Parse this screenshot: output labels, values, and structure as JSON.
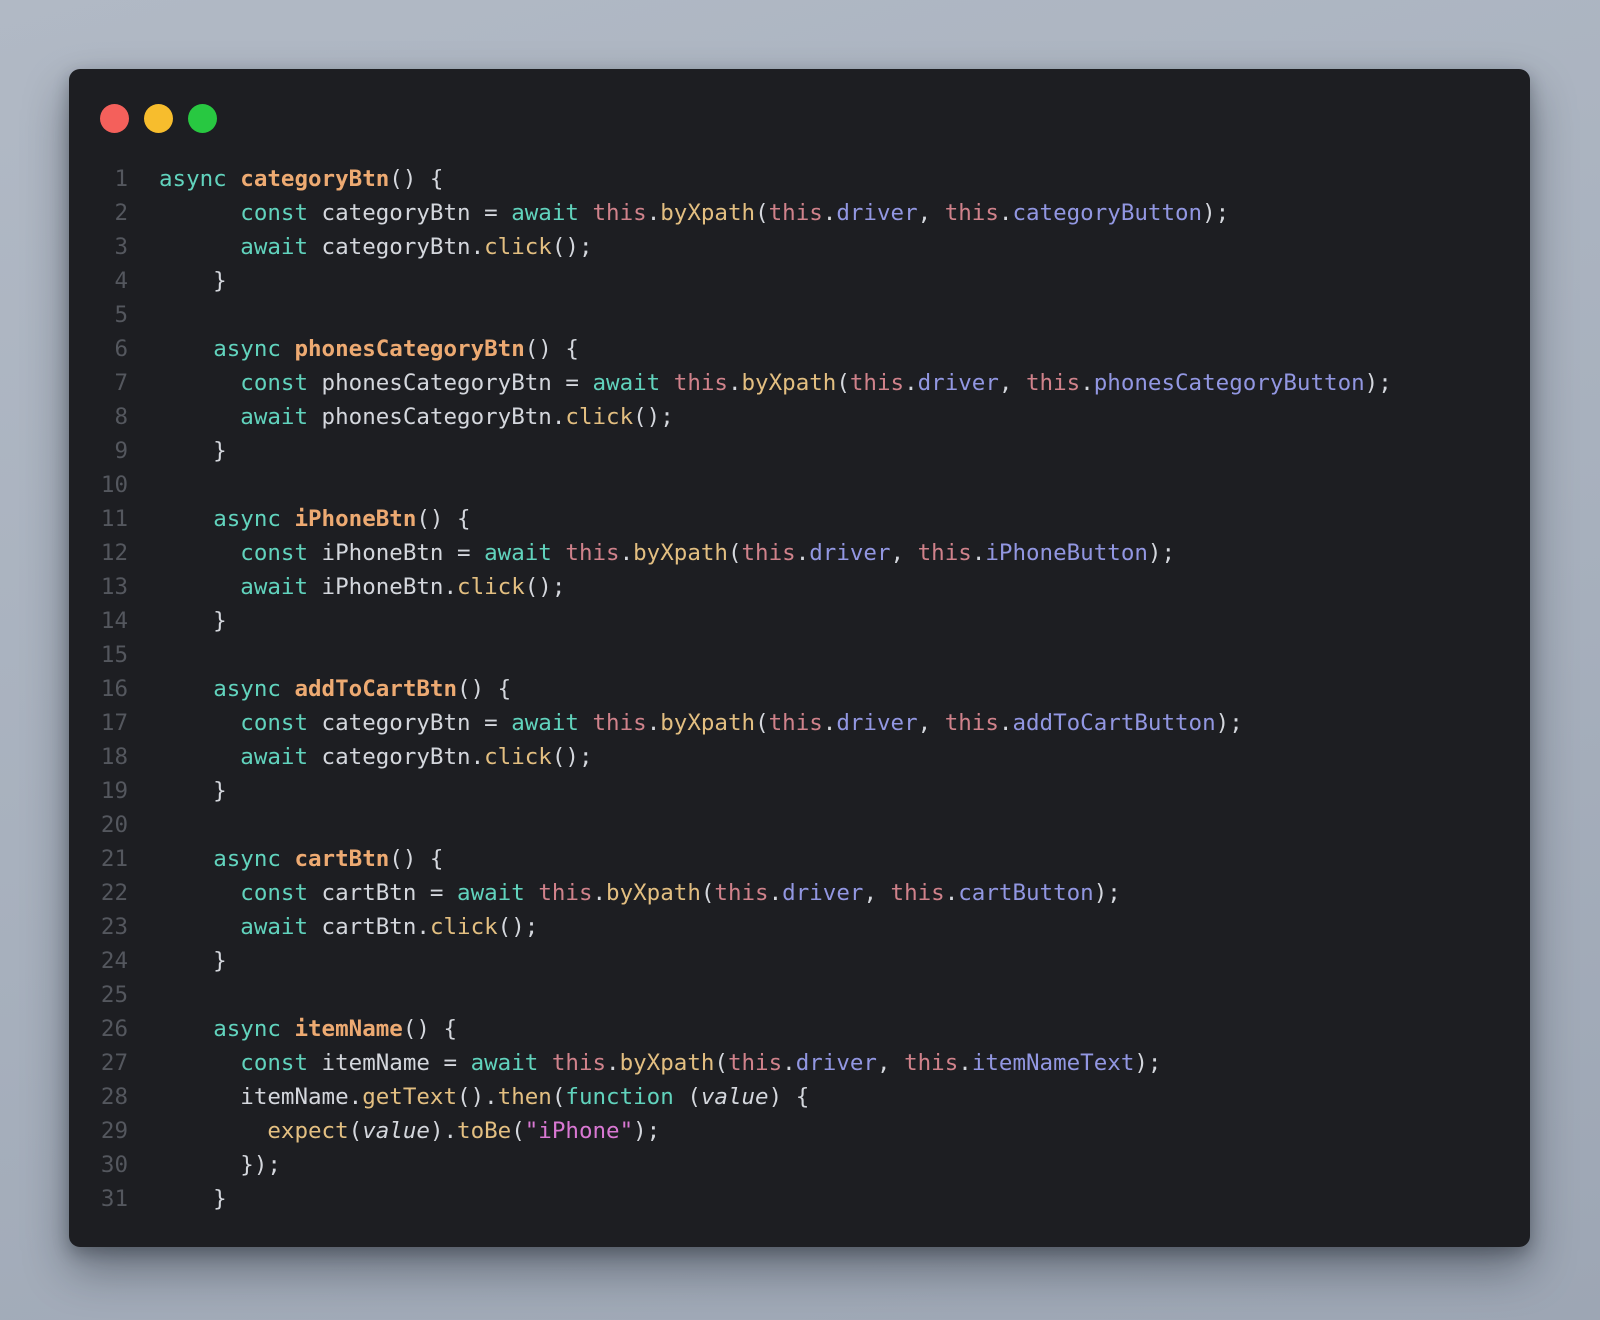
{
  "palette": {
    "page_top": "#b1b9c5",
    "page_bottom": "#9da6b4",
    "window_bg": "#1d1e22",
    "dot_red": "#f4605b",
    "dot_yellow": "#f7bd2d",
    "dot_green": "#28c841",
    "ln": "#54575e",
    "kw": "#61d3bd",
    "fn": "#edaa72",
    "pln": "#d4d7dd",
    "self": "#d0828b",
    "meth": "#e3bf81",
    "prop": "#9297e2",
    "str": "#d978d3",
    "param": "#d4d7dd"
  },
  "window": {
    "controls": [
      {
        "name": "close",
        "color_key": "dot_red"
      },
      {
        "name": "minimize",
        "color_key": "dot_yellow"
      },
      {
        "name": "zoom",
        "color_key": "dot_green"
      }
    ]
  },
  "editor": {
    "lines": [
      {
        "n": "1",
        "tokens": [
          [
            "kw",
            "async "
          ],
          [
            "fn",
            "categoryBtn"
          ],
          [
            "pln",
            "() {"
          ]
        ]
      },
      {
        "n": "2",
        "tokens": [
          [
            "pln",
            "      "
          ],
          [
            "kw",
            "const"
          ],
          [
            "pln",
            " categoryBtn = "
          ],
          [
            "kw",
            "await"
          ],
          [
            "pln",
            " "
          ],
          [
            "self",
            "this"
          ],
          [
            "pln",
            "."
          ],
          [
            "meth",
            "byXpath"
          ],
          [
            "pln",
            "("
          ],
          [
            "self",
            "this"
          ],
          [
            "pln",
            "."
          ],
          [
            "prop",
            "driver"
          ],
          [
            "pln",
            ", "
          ],
          [
            "self",
            "this"
          ],
          [
            "pln",
            "."
          ],
          [
            "prop",
            "categoryButton"
          ],
          [
            "pln",
            ");"
          ]
        ]
      },
      {
        "n": "3",
        "tokens": [
          [
            "pln",
            "      "
          ],
          [
            "kw",
            "await"
          ],
          [
            "pln",
            " categoryBtn."
          ],
          [
            "meth",
            "click"
          ],
          [
            "pln",
            "();"
          ]
        ]
      },
      {
        "n": "4",
        "tokens": [
          [
            "pln",
            "    }"
          ]
        ]
      },
      {
        "n": "5",
        "tokens": []
      },
      {
        "n": "6",
        "tokens": [
          [
            "pln",
            "    "
          ],
          [
            "kw",
            "async "
          ],
          [
            "fn",
            "phonesCategoryBtn"
          ],
          [
            "pln",
            "() {"
          ]
        ]
      },
      {
        "n": "7",
        "tokens": [
          [
            "pln",
            "      "
          ],
          [
            "kw",
            "const"
          ],
          [
            "pln",
            " phonesCategoryBtn = "
          ],
          [
            "kw",
            "await"
          ],
          [
            "pln",
            " "
          ],
          [
            "self",
            "this"
          ],
          [
            "pln",
            "."
          ],
          [
            "meth",
            "byXpath"
          ],
          [
            "pln",
            "("
          ],
          [
            "self",
            "this"
          ],
          [
            "pln",
            "."
          ],
          [
            "prop",
            "driver"
          ],
          [
            "pln",
            ", "
          ],
          [
            "self",
            "this"
          ],
          [
            "pln",
            "."
          ],
          [
            "prop",
            "phonesCategoryButton"
          ],
          [
            "pln",
            ");"
          ]
        ]
      },
      {
        "n": "8",
        "tokens": [
          [
            "pln",
            "      "
          ],
          [
            "kw",
            "await"
          ],
          [
            "pln",
            " phonesCategoryBtn."
          ],
          [
            "meth",
            "click"
          ],
          [
            "pln",
            "();"
          ]
        ]
      },
      {
        "n": "9",
        "tokens": [
          [
            "pln",
            "    }"
          ]
        ]
      },
      {
        "n": "10",
        "tokens": []
      },
      {
        "n": "11",
        "tokens": [
          [
            "pln",
            "    "
          ],
          [
            "kw",
            "async "
          ],
          [
            "fn",
            "iPhoneBtn"
          ],
          [
            "pln",
            "() {"
          ]
        ]
      },
      {
        "n": "12",
        "tokens": [
          [
            "pln",
            "      "
          ],
          [
            "kw",
            "const"
          ],
          [
            "pln",
            " iPhoneBtn = "
          ],
          [
            "kw",
            "await"
          ],
          [
            "pln",
            " "
          ],
          [
            "self",
            "this"
          ],
          [
            "pln",
            "."
          ],
          [
            "meth",
            "byXpath"
          ],
          [
            "pln",
            "("
          ],
          [
            "self",
            "this"
          ],
          [
            "pln",
            "."
          ],
          [
            "prop",
            "driver"
          ],
          [
            "pln",
            ", "
          ],
          [
            "self",
            "this"
          ],
          [
            "pln",
            "."
          ],
          [
            "prop",
            "iPhoneButton"
          ],
          [
            "pln",
            ");"
          ]
        ]
      },
      {
        "n": "13",
        "tokens": [
          [
            "pln",
            "      "
          ],
          [
            "kw",
            "await"
          ],
          [
            "pln",
            " iPhoneBtn."
          ],
          [
            "meth",
            "click"
          ],
          [
            "pln",
            "();"
          ]
        ]
      },
      {
        "n": "14",
        "tokens": [
          [
            "pln",
            "    }"
          ]
        ]
      },
      {
        "n": "15",
        "tokens": []
      },
      {
        "n": "16",
        "tokens": [
          [
            "pln",
            "    "
          ],
          [
            "kw",
            "async "
          ],
          [
            "fn",
            "addToCartBtn"
          ],
          [
            "pln",
            "() {"
          ]
        ]
      },
      {
        "n": "17",
        "tokens": [
          [
            "pln",
            "      "
          ],
          [
            "kw",
            "const"
          ],
          [
            "pln",
            " categoryBtn = "
          ],
          [
            "kw",
            "await"
          ],
          [
            "pln",
            " "
          ],
          [
            "self",
            "this"
          ],
          [
            "pln",
            "."
          ],
          [
            "meth",
            "byXpath"
          ],
          [
            "pln",
            "("
          ],
          [
            "self",
            "this"
          ],
          [
            "pln",
            "."
          ],
          [
            "prop",
            "driver"
          ],
          [
            "pln",
            ", "
          ],
          [
            "self",
            "this"
          ],
          [
            "pln",
            "."
          ],
          [
            "prop",
            "addToCartButton"
          ],
          [
            "pln",
            ");"
          ]
        ]
      },
      {
        "n": "18",
        "tokens": [
          [
            "pln",
            "      "
          ],
          [
            "kw",
            "await"
          ],
          [
            "pln",
            " categoryBtn."
          ],
          [
            "meth",
            "click"
          ],
          [
            "pln",
            "();"
          ]
        ]
      },
      {
        "n": "19",
        "tokens": [
          [
            "pln",
            "    }"
          ]
        ]
      },
      {
        "n": "20",
        "tokens": []
      },
      {
        "n": "21",
        "tokens": [
          [
            "pln",
            "    "
          ],
          [
            "kw",
            "async "
          ],
          [
            "fn",
            "cartBtn"
          ],
          [
            "pln",
            "() {"
          ]
        ]
      },
      {
        "n": "22",
        "tokens": [
          [
            "pln",
            "      "
          ],
          [
            "kw",
            "const"
          ],
          [
            "pln",
            " cartBtn = "
          ],
          [
            "kw",
            "await"
          ],
          [
            "pln",
            " "
          ],
          [
            "self",
            "this"
          ],
          [
            "pln",
            "."
          ],
          [
            "meth",
            "byXpath"
          ],
          [
            "pln",
            "("
          ],
          [
            "self",
            "this"
          ],
          [
            "pln",
            "."
          ],
          [
            "prop",
            "driver"
          ],
          [
            "pln",
            ", "
          ],
          [
            "self",
            "this"
          ],
          [
            "pln",
            "."
          ],
          [
            "prop",
            "cartButton"
          ],
          [
            "pln",
            ");"
          ]
        ]
      },
      {
        "n": "23",
        "tokens": [
          [
            "pln",
            "      "
          ],
          [
            "kw",
            "await"
          ],
          [
            "pln",
            " cartBtn."
          ],
          [
            "meth",
            "click"
          ],
          [
            "pln",
            "();"
          ]
        ]
      },
      {
        "n": "24",
        "tokens": [
          [
            "pln",
            "    }"
          ]
        ]
      },
      {
        "n": "25",
        "tokens": []
      },
      {
        "n": "26",
        "tokens": [
          [
            "pln",
            "    "
          ],
          [
            "kw",
            "async "
          ],
          [
            "fn",
            "itemName"
          ],
          [
            "pln",
            "() {"
          ]
        ]
      },
      {
        "n": "27",
        "tokens": [
          [
            "pln",
            "      "
          ],
          [
            "kw",
            "const"
          ],
          [
            "pln",
            " itemName = "
          ],
          [
            "kw",
            "await"
          ],
          [
            "pln",
            " "
          ],
          [
            "self",
            "this"
          ],
          [
            "pln",
            "."
          ],
          [
            "meth",
            "byXpath"
          ],
          [
            "pln",
            "("
          ],
          [
            "self",
            "this"
          ],
          [
            "pln",
            "."
          ],
          [
            "prop",
            "driver"
          ],
          [
            "pln",
            ", "
          ],
          [
            "self",
            "this"
          ],
          [
            "pln",
            "."
          ],
          [
            "prop",
            "itemNameText"
          ],
          [
            "pln",
            ");"
          ]
        ]
      },
      {
        "n": "28",
        "tokens": [
          [
            "pln",
            "      itemName."
          ],
          [
            "meth",
            "getText"
          ],
          [
            "pln",
            "()."
          ],
          [
            "meth",
            "then"
          ],
          [
            "pln",
            "("
          ],
          [
            "kw",
            "function"
          ],
          [
            "pln",
            " ("
          ],
          [
            "param",
            "value"
          ],
          [
            "pln",
            ") {"
          ]
        ]
      },
      {
        "n": "29",
        "tokens": [
          [
            "pln",
            "        "
          ],
          [
            "meth",
            "expect"
          ],
          [
            "pln",
            "("
          ],
          [
            "param",
            "value"
          ],
          [
            "pln",
            ")."
          ],
          [
            "meth",
            "toBe"
          ],
          [
            "pln",
            "("
          ],
          [
            "str",
            "\"iPhone\""
          ],
          [
            "pln",
            ");"
          ]
        ]
      },
      {
        "n": "30",
        "tokens": [
          [
            "pln",
            "      });"
          ]
        ]
      },
      {
        "n": "31",
        "tokens": [
          [
            "pln",
            "    }"
          ]
        ]
      }
    ]
  }
}
